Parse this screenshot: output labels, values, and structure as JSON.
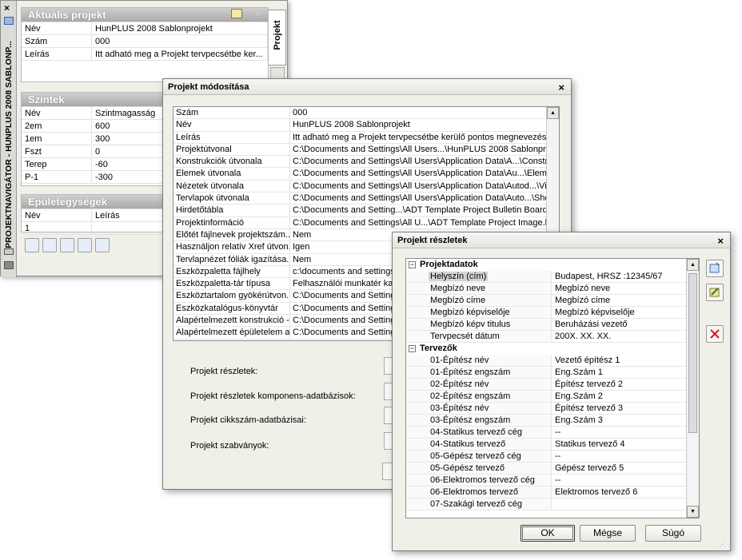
{
  "palette": {
    "vertical_title": "PROJEKTNAVIGÁTOR - HUNPLUS 2008 SABLONP...",
    "side_tab": "Projekt",
    "current": {
      "title": "Aktuális projekt",
      "rows": [
        {
          "key": "Név",
          "value": "HunPLUS 2008 Sablonprojekt"
        },
        {
          "key": "Szám",
          "value": "000"
        },
        {
          "key": "Leírás",
          "value": "Itt adható meg a Projekt tervpecsétbe ker..."
        }
      ]
    },
    "levels": {
      "title": "Szintek",
      "headers": [
        "Név",
        "Szintmagasság"
      ],
      "rows": [
        [
          "2em",
          "600"
        ],
        [
          "1em",
          "300"
        ],
        [
          "Fszt",
          "0"
        ],
        [
          "Terep",
          "-60"
        ],
        [
          "P-1",
          "-300"
        ]
      ]
    },
    "units": {
      "title": "Épületegységek",
      "headers": [
        "Név",
        "Leírás"
      ],
      "rows": [
        [
          "1",
          ""
        ]
      ]
    }
  },
  "modify_dialog": {
    "title": "Projekt módosítása",
    "rows": [
      [
        "Szám",
        "000"
      ],
      [
        "Név",
        "HunPLUS 2008 Sablonprojekt"
      ],
      [
        "Leírás",
        "Itt adható meg a Projekt tervpecsétbe kerülő pontos megnevezése"
      ],
      [
        "Projektútvonal",
        "C:\\Documents and Settings\\All Users...\\HunPLUS 2008 Sablonprojekt"
      ],
      [
        "Konstrukciók útvonala",
        "C:\\Documents and Settings\\All Users\\Application Data\\A...\\Constructs"
      ],
      [
        "Elemek útvonala",
        "C:\\Documents and Settings\\All Users\\Application Data\\Au...\\Elements"
      ],
      [
        "Nézetek útvonala",
        "C:\\Documents and Settings\\All Users\\Application Data\\Autod...\\Views"
      ],
      [
        "Tervlapok útvonala",
        "C:\\Documents and Settings\\All Users\\Application Data\\Auto...\\Sheets"
      ],
      [
        "Hirdetőtábla",
        "C:\\Documents and Setting...\\ADT Template Project Bulletin Board.htm"
      ],
      [
        "Projektinformáció",
        "C:\\Documents and Settings\\All U...\\ADT Template Project Image.bmp"
      ],
      [
        "Előtét fájlnevek projektszám...",
        "Nem"
      ],
      [
        "Használjon relatív Xref útvon...",
        "Igen"
      ],
      [
        "Tervlapnézet fóliák igazítása...",
        "Nem"
      ],
      [
        "Eszközpaletta fájlhely",
        "c:\\documents and settings\\a"
      ],
      [
        "Eszközpaletta-tár típusa",
        "Felhasználói munkatér katalo"
      ],
      [
        "Eszköztartalom gyökérútvon...",
        "C:\\Documents and Settings\\"
      ],
      [
        "Eszközkatalógus-könyvtár",
        "C:\\Documents and Settings\\"
      ],
      [
        "Alapértelmezett konstrukció -...",
        "C:\\Documents and Settings\\"
      ],
      [
        "Alapértelmezett épületelem a...",
        "C:\\Documents and Settings\\"
      ]
    ],
    "labels": [
      "Projekt részletek:",
      "Projekt részletek komponens-adatbázisok:",
      "Projekt cikkszám-adatbázisai:",
      "Projekt szabványok:"
    ]
  },
  "details_dialog": {
    "title": "Projekt részletek",
    "categories": [
      {
        "name": "Projektadatok",
        "props": [
          [
            "Helyszín (cím)",
            "Budapest,  HRSZ :12345/67"
          ],
          [
            "Megbízó neve",
            "Megbízó neve"
          ],
          [
            "Megbízó címe",
            "Megbízó címe"
          ],
          [
            "Megbízó képviselője",
            "Megbízó képviselője"
          ],
          [
            "Megbízó képv titulus",
            "Beruházási vezető"
          ],
          [
            "Tervpecsét dátum",
            "200X. XX. XX."
          ]
        ]
      },
      {
        "name": "Tervezők",
        "props": [
          [
            "01-Építész név",
            "Vezető építész 1"
          ],
          [
            "01-Építész engszám",
            "Eng.Szám 1"
          ],
          [
            "02-Építész név",
            "Építész tervező 2"
          ],
          [
            "02-Építész engszám",
            "Eng.Szám 2"
          ],
          [
            "03-Építész név",
            "Építész tervező 3"
          ],
          [
            "03-Építész engszám",
            "Eng.Szám 3"
          ],
          [
            "04-Statikus tervező cég",
            "--"
          ],
          [
            "04-Statikus tervező",
            "Statikus tervező 4"
          ],
          [
            "05-Gépész tervező cég",
            "--"
          ],
          [
            "05-Gépész tervező",
            "Gépész tervező 5"
          ],
          [
            "06-Elektromos tervező cég",
            "--"
          ],
          [
            "06-Elektromos tervező",
            "Elektromos tervező 6"
          ],
          [
            "07-Szakági tervező cég",
            ""
          ]
        ]
      }
    ],
    "buttons": {
      "ok": "OK",
      "cancel": "Mégse",
      "help": "Súgó"
    },
    "close": "×"
  }
}
